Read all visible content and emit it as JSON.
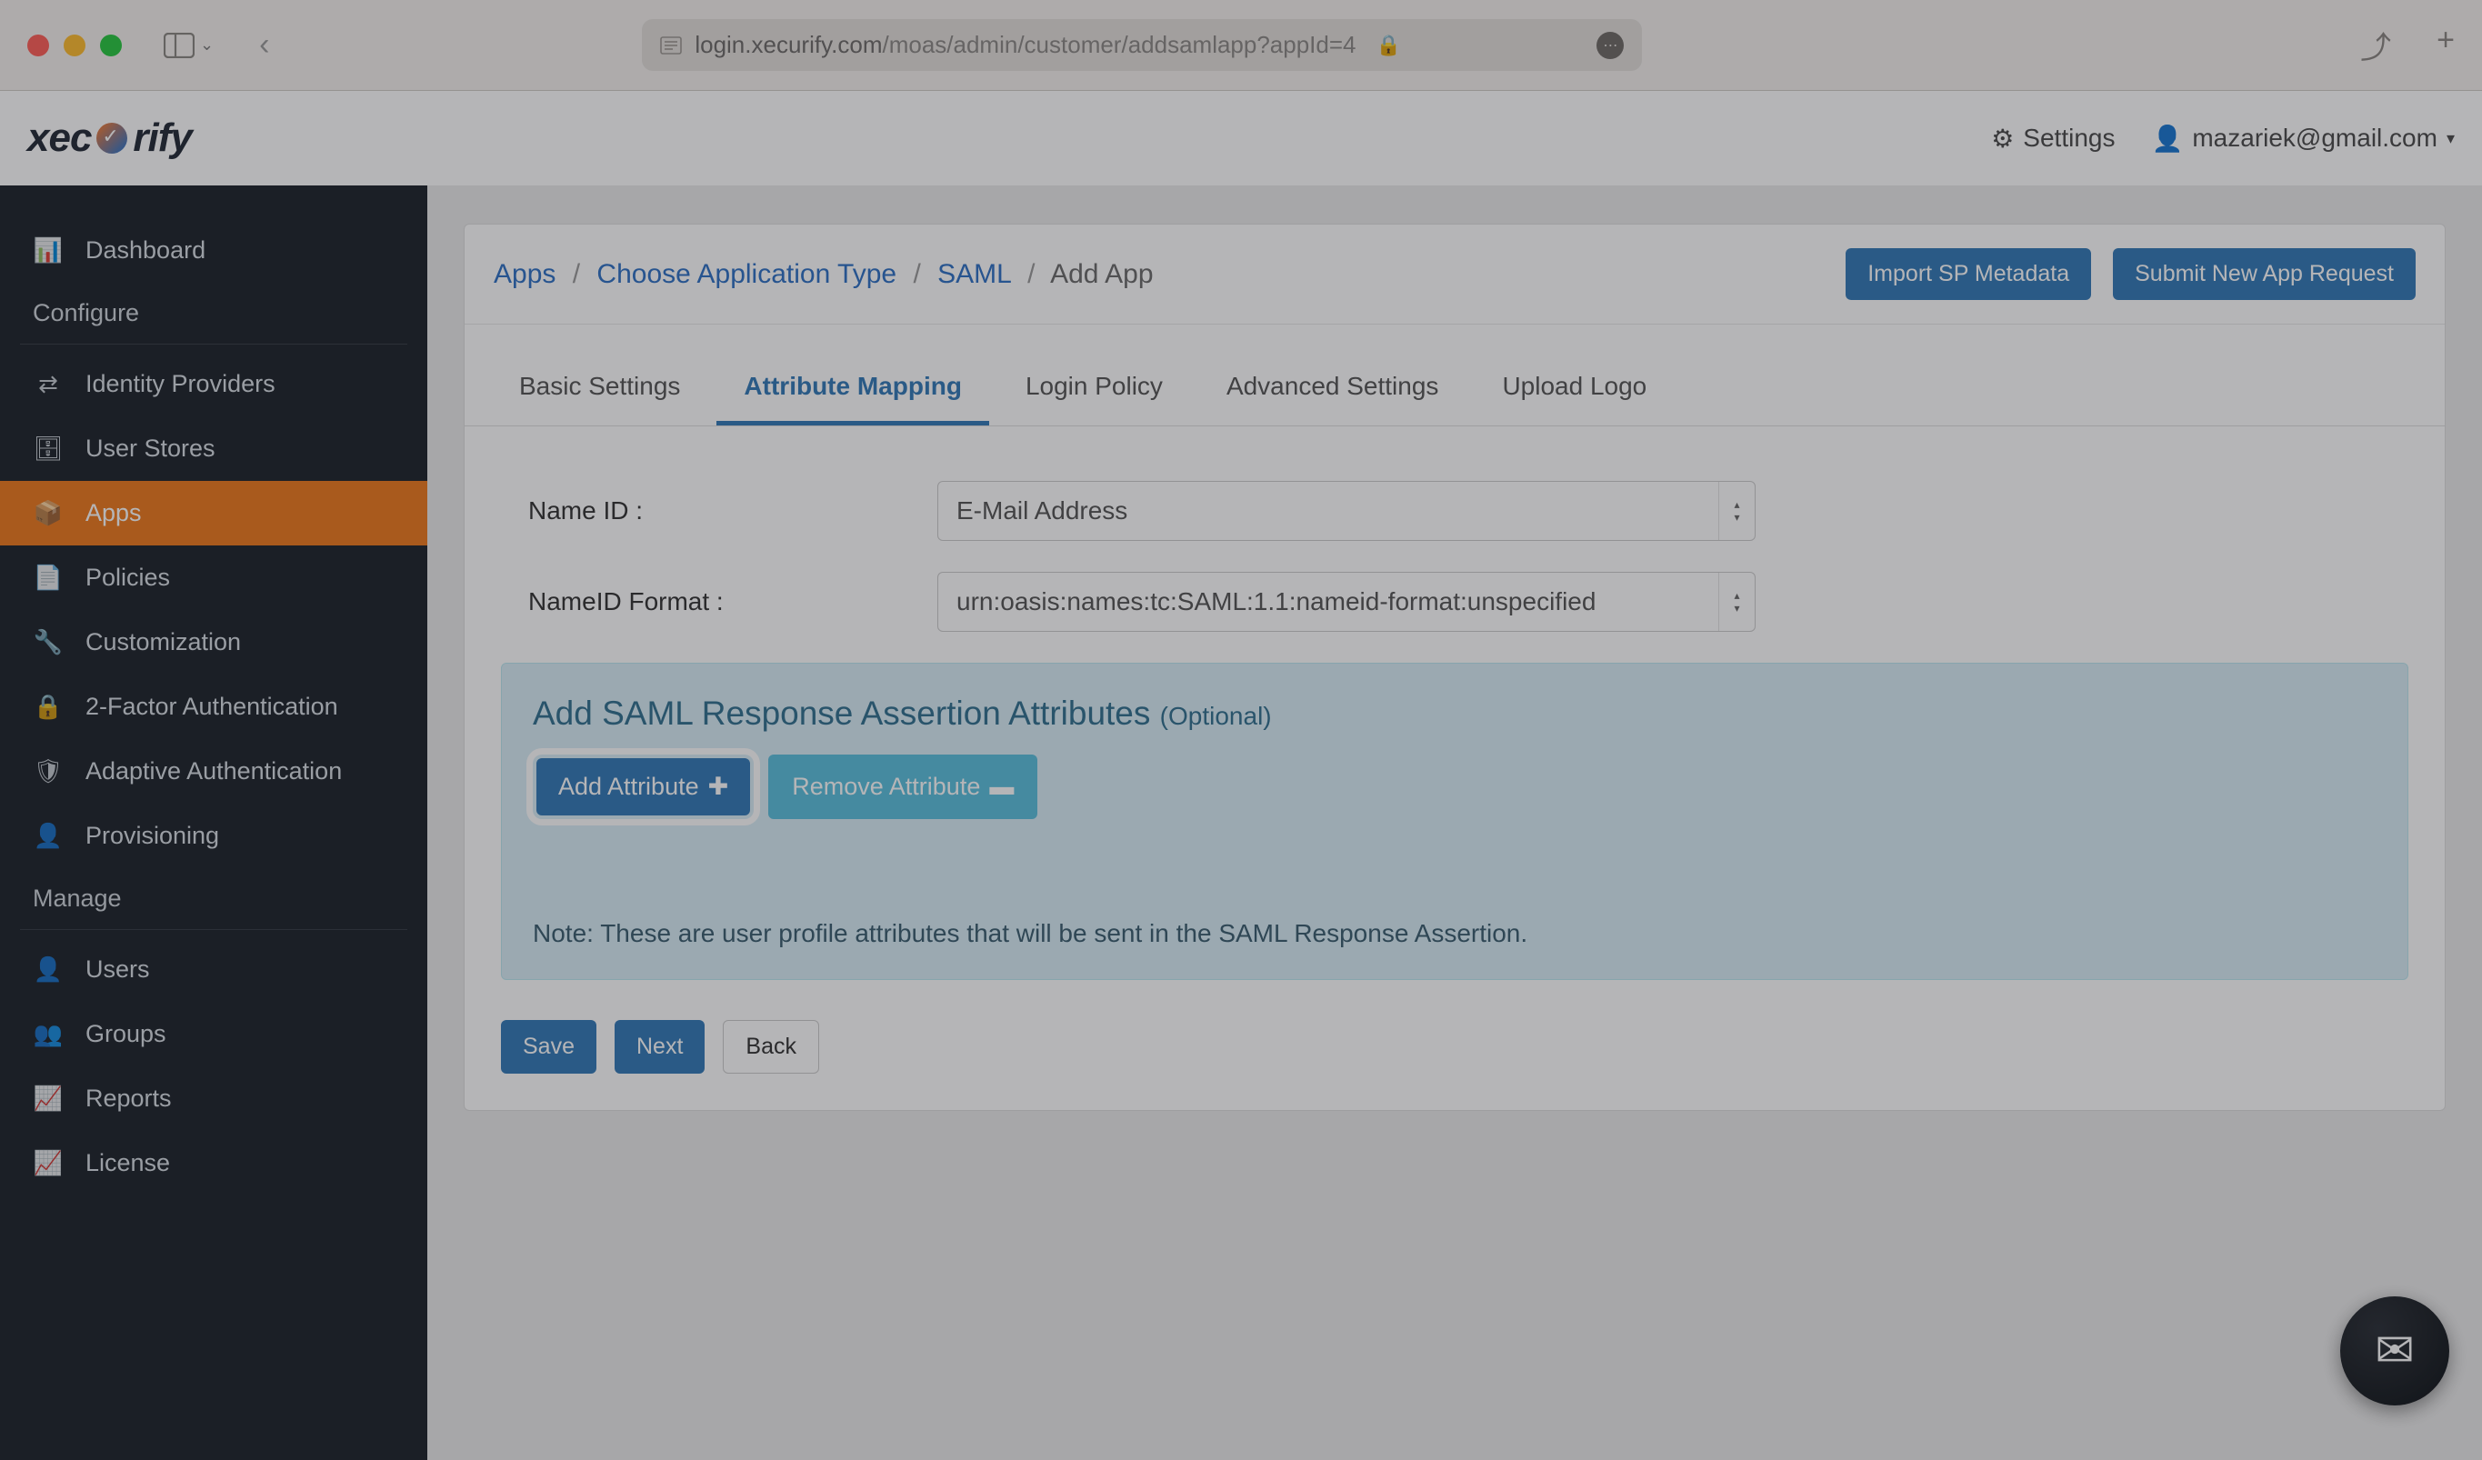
{
  "browser": {
    "url_host": "login.xecurify.com",
    "url_path": "/moas/admin/customer/addsamlapp?appId=4"
  },
  "logo": {
    "prefix": "xec",
    "suffix": "rify"
  },
  "header": {
    "settings_label": "Settings",
    "user_email": "mazariek@gmail.com"
  },
  "sidebar": {
    "section_configure": "Configure",
    "items_configure": [
      {
        "key": "dashboard",
        "label": "Dashboard",
        "icon": "📊"
      },
      {
        "key": "identity-providers",
        "label": "Identity Providers",
        "icon": "⇄"
      },
      {
        "key": "user-stores",
        "label": "User Stores",
        "icon": "🗄"
      },
      {
        "key": "apps",
        "label": "Apps",
        "icon": "📦",
        "active": true
      },
      {
        "key": "policies",
        "label": "Policies",
        "icon": "📄"
      },
      {
        "key": "customization",
        "label": "Customization",
        "icon": "🔧"
      },
      {
        "key": "2fa",
        "label": "2-Factor Authentication",
        "icon": "🔒"
      },
      {
        "key": "adaptive-auth",
        "label": "Adaptive Authentication",
        "icon": "🛡"
      },
      {
        "key": "provisioning",
        "label": "Provisioning",
        "icon": "👤"
      }
    ],
    "section_manage": "Manage",
    "items_manage": [
      {
        "key": "users",
        "label": "Users",
        "icon": "👤"
      },
      {
        "key": "groups",
        "label": "Groups",
        "icon": "👥"
      },
      {
        "key": "reports",
        "label": "Reports",
        "icon": "📈"
      },
      {
        "key": "license",
        "label": "License",
        "icon": "📈"
      }
    ]
  },
  "breadcrumbs": {
    "items": [
      {
        "label": "Apps"
      },
      {
        "label": "Choose Application Type"
      },
      {
        "label": "SAML"
      },
      {
        "label": "Add App",
        "current": true
      }
    ]
  },
  "actions": {
    "import_metadata": "Import SP Metadata",
    "submit_request": "Submit New App Request"
  },
  "tabs": {
    "items": [
      {
        "key": "basic",
        "label": "Basic Settings"
      },
      {
        "key": "attribute-mapping",
        "label": "Attribute Mapping",
        "active": true
      },
      {
        "key": "login-policy",
        "label": "Login Policy"
      },
      {
        "key": "advanced",
        "label": "Advanced Settings"
      },
      {
        "key": "upload-logo",
        "label": "Upload Logo"
      }
    ]
  },
  "form": {
    "name_id_label": "Name ID :",
    "name_id_value": "E-Mail Address",
    "nameid_format_label": "NameID Format :",
    "nameid_format_value": "urn:oasis:names:tc:SAML:1.1:nameid-format:unspecified"
  },
  "attr_panel": {
    "title_main": "Add SAML Response Assertion Attributes ",
    "title_optional": "(Optional)",
    "add_btn": "Add Attribute",
    "remove_btn": "Remove Attribute",
    "note": "Note: These are user profile attributes that will be sent in the SAML Response Assertion."
  },
  "footer": {
    "save": "Save",
    "next": "Next",
    "back": "Back"
  }
}
